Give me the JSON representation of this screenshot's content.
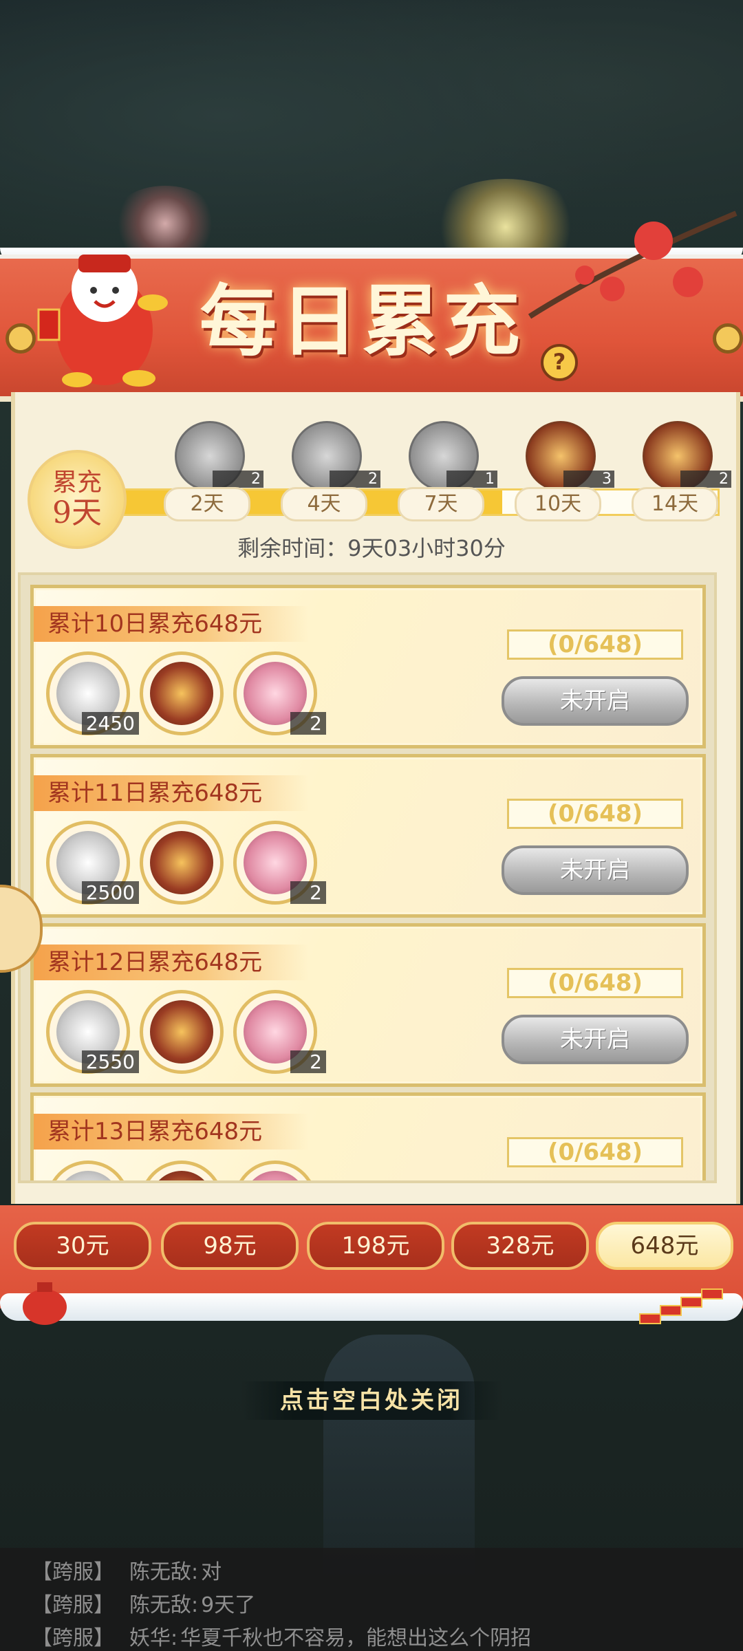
{
  "banner": {
    "title": "每日累充",
    "help_icon": "question-icon"
  },
  "progress": {
    "badge_line1": "累充",
    "badge_line2": "9天",
    "fill_fraction": 0.64,
    "milestones": [
      {
        "label": "2天",
        "count": "2",
        "icon": "silver-chest-icon"
      },
      {
        "label": "4天",
        "count": "2",
        "icon": "silver-chest-icon"
      },
      {
        "label": "7天",
        "count": "1",
        "icon": "dragon-weapon-icon"
      },
      {
        "label": "10天",
        "count": "3",
        "icon": "treasure-chest-icon"
      },
      {
        "label": "14天",
        "count": "2",
        "icon": "jade-weapon-icon"
      }
    ],
    "timer": "剩余时间：9天03小时30分"
  },
  "tasks": [
    {
      "title": "累计10日累充648元",
      "progress": "(0/648)",
      "button": "未开启",
      "rewards": [
        {
          "icon": "silver-ingot-icon",
          "count": "2450"
        },
        {
          "icon": "treasure-chest-icon",
          "count": ""
        },
        {
          "icon": "gift-box-icon",
          "count": "2"
        }
      ]
    },
    {
      "title": "累计11日累充648元",
      "progress": "(0/648)",
      "button": "未开启",
      "rewards": [
        {
          "icon": "silver-ingot-icon",
          "count": "2500"
        },
        {
          "icon": "treasure-chest-icon",
          "count": ""
        },
        {
          "icon": "gift-box-icon",
          "count": "2"
        }
      ]
    },
    {
      "title": "累计12日累充648元",
      "progress": "(0/648)",
      "button": "未开启",
      "rewards": [
        {
          "icon": "silver-ingot-icon",
          "count": "2550"
        },
        {
          "icon": "treasure-chest-icon",
          "count": ""
        },
        {
          "icon": "gift-box-icon",
          "count": "2"
        }
      ]
    },
    {
      "title": "累计13日累充648元",
      "progress": "(0/648)",
      "button": "",
      "rewards": []
    }
  ],
  "tiers": [
    "30元",
    "98元",
    "198元",
    "328元",
    "648元"
  ],
  "active_tier": "648元",
  "close_tip": "点击空白处关闭",
  "chat": [
    {
      "channel": "【跨服】",
      "speaker": "陈无敌:",
      "text": "对"
    },
    {
      "channel": "【跨服】",
      "speaker": "陈无敌:",
      "text": "9天了"
    },
    {
      "channel": "【跨服】",
      "speaker": "妖华:",
      "text": "华夏千秋也不容易，能想出这么个阴招"
    }
  ],
  "colors": {
    "banner_red": "#e0553a",
    "gold": "#f6c735",
    "panel": "#f7f0da",
    "button_gray": "#b5b5b5"
  }
}
